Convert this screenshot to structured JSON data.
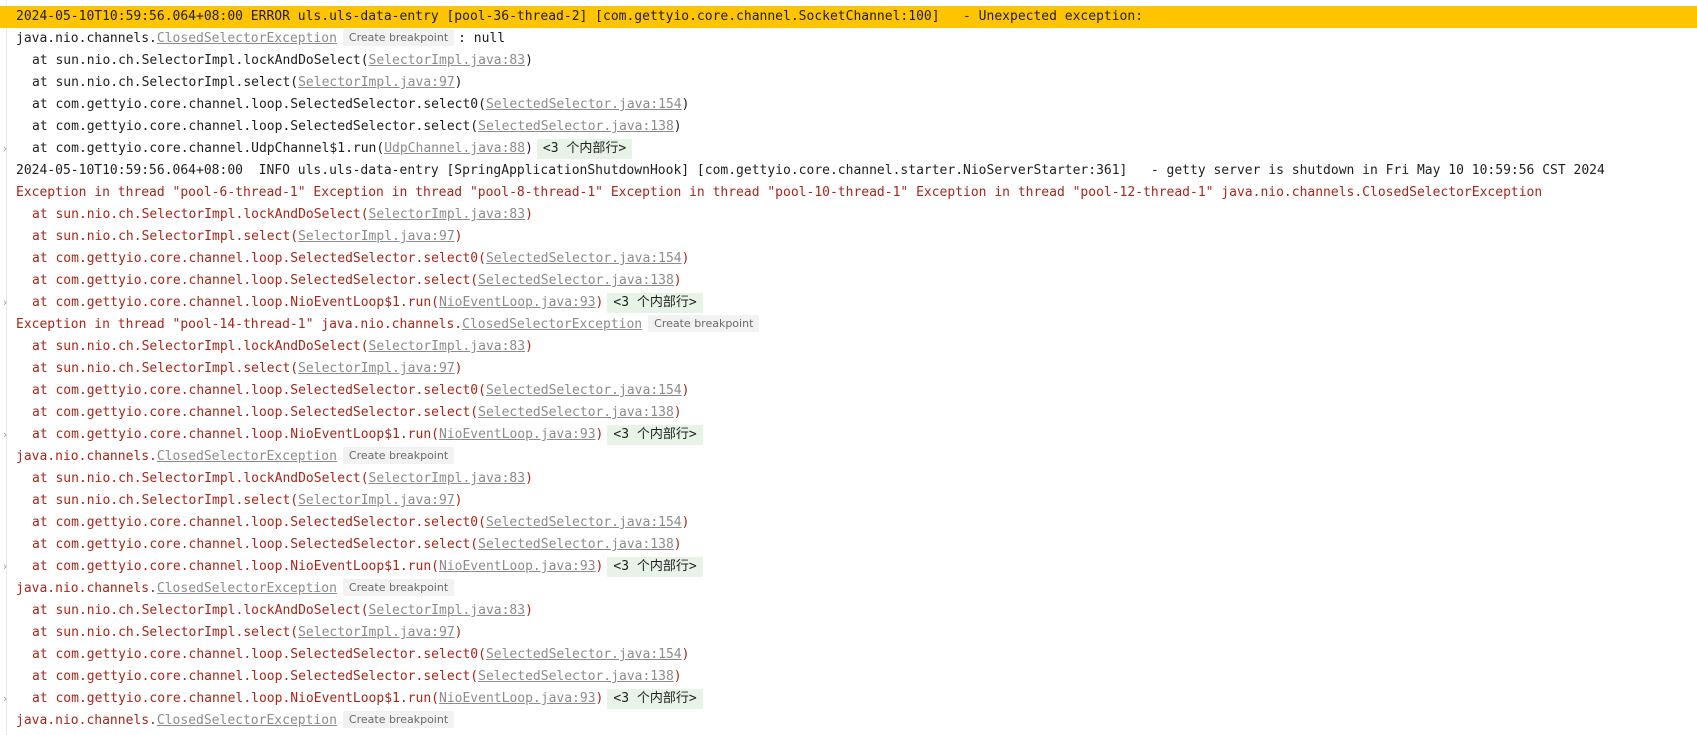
{
  "colors": {
    "error_highlight": "#ffc400",
    "error_text": "#a8261a",
    "link": "#8c8c8c",
    "folded_frames_bg": "#e6f3e6"
  },
  "bp_label": "Create breakpoint",
  "folded_label": "<3 个内部行>",
  "lines": {
    "l01": {
      "text": "2024-05-10T10:59:56.064+08:00 ERROR uls.uls-data-entry [pool-36-thread-2] [com.gettyio.core.channel.SocketChannel:100]   - Unexpected exception:"
    },
    "l02": {
      "pre": "java.nio.channels.",
      "link": "ClosedSelectorException",
      "post": ": null"
    },
    "l03": {
      "pre": "at sun.nio.ch.SelectorImpl.lockAndDoSelect(",
      "link": "SelectorImpl.java:83",
      "post": ")"
    },
    "l04": {
      "pre": "at sun.nio.ch.SelectorImpl.select(",
      "link": "SelectorImpl.java:97",
      "post": ")"
    },
    "l05": {
      "pre": "at com.gettyio.core.channel.loop.SelectedSelector.select0(",
      "link": "SelectedSelector.java:154",
      "post": ")"
    },
    "l06": {
      "pre": "at com.gettyio.core.channel.loop.SelectedSelector.select(",
      "link": "SelectedSelector.java:138",
      "post": ")"
    },
    "l07": {
      "pre": "at com.gettyio.core.channel.UdpChannel$1.run(",
      "link": "UdpChannel.java:88",
      "post": ")"
    },
    "l08": {
      "text": "2024-05-10T10:59:56.064+08:00  INFO uls.uls-data-entry [SpringApplicationShutdownHook] [com.gettyio.core.channel.starter.NioServerStarter:361]   - getty server is shutdown in Fri May 10 10:59:56 CST 2024"
    },
    "l09": {
      "text": "Exception in thread \"pool-6-thread-1\" Exception in thread \"pool-8-thread-1\" Exception in thread \"pool-10-thread-1\" Exception in thread \"pool-12-thread-1\" java.nio.channels.ClosedSelectorException"
    },
    "l10": {
      "pre": "at sun.nio.ch.SelectorImpl.lockAndDoSelect(",
      "link": "SelectorImpl.java:83",
      "post": ")"
    },
    "l11": {
      "pre": "at sun.nio.ch.SelectorImpl.select(",
      "link": "SelectorImpl.java:97",
      "post": ")"
    },
    "l12": {
      "pre": "at com.gettyio.core.channel.loop.SelectedSelector.select0(",
      "link": "SelectedSelector.java:154",
      "post": ")"
    },
    "l13": {
      "pre": "at com.gettyio.core.channel.loop.SelectedSelector.select(",
      "link": "SelectedSelector.java:138",
      "post": ")"
    },
    "l14": {
      "pre": "at com.gettyio.core.channel.loop.NioEventLoop$1.run(",
      "link": "NioEventLoop.java:93",
      "post": ")"
    },
    "l15": {
      "pre": "Exception in thread \"pool-14-thread-1\" java.nio.channels.",
      "link": "ClosedSelectorException"
    },
    "l16": {
      "pre": "at sun.nio.ch.SelectorImpl.lockAndDoSelect(",
      "link": "SelectorImpl.java:83",
      "post": ")"
    },
    "l17": {
      "pre": "at sun.nio.ch.SelectorImpl.select(",
      "link": "SelectorImpl.java:97",
      "post": ")"
    },
    "l18": {
      "pre": "at com.gettyio.core.channel.loop.SelectedSelector.select0(",
      "link": "SelectedSelector.java:154",
      "post": ")"
    },
    "l19": {
      "pre": "at com.gettyio.core.channel.loop.SelectedSelector.select(",
      "link": "SelectedSelector.java:138",
      "post": ")"
    },
    "l20": {
      "pre": "at com.gettyio.core.channel.loop.NioEventLoop$1.run(",
      "link": "NioEventLoop.java:93",
      "post": ")"
    },
    "l21": {
      "pre": "java.nio.channels.",
      "link": "ClosedSelectorException"
    },
    "l22": {
      "pre": "at sun.nio.ch.SelectorImpl.lockAndDoSelect(",
      "link": "SelectorImpl.java:83",
      "post": ")"
    },
    "l23": {
      "pre": "at sun.nio.ch.SelectorImpl.select(",
      "link": "SelectorImpl.java:97",
      "post": ")"
    },
    "l24": {
      "pre": "at com.gettyio.core.channel.loop.SelectedSelector.select0(",
      "link": "SelectedSelector.java:154",
      "post": ")"
    },
    "l25": {
      "pre": "at com.gettyio.core.channel.loop.SelectedSelector.select(",
      "link": "SelectedSelector.java:138",
      "post": ")"
    },
    "l26": {
      "pre": "at com.gettyio.core.channel.loop.NioEventLoop$1.run(",
      "link": "NioEventLoop.java:93",
      "post": ")"
    },
    "l27": {
      "pre": "java.nio.channels.",
      "link": "ClosedSelectorException"
    },
    "l28": {
      "pre": "at sun.nio.ch.SelectorImpl.lockAndDoSelect(",
      "link": "SelectorImpl.java:83",
      "post": ")"
    },
    "l29": {
      "pre": "at sun.nio.ch.SelectorImpl.select(",
      "link": "SelectorImpl.java:97",
      "post": ")"
    },
    "l30": {
      "pre": "at com.gettyio.core.channel.loop.SelectedSelector.select0(",
      "link": "SelectedSelector.java:154",
      "post": ")"
    },
    "l31": {
      "pre": "at com.gettyio.core.channel.loop.SelectedSelector.select(",
      "link": "SelectedSelector.java:138",
      "post": ")"
    },
    "l32": {
      "pre": "at com.gettyio.core.channel.loop.NioEventLoop$1.run(",
      "link": "NioEventLoop.java:93",
      "post": ")"
    },
    "l33": {
      "pre": "java.nio.channels.",
      "link": "ClosedSelectorException"
    }
  }
}
